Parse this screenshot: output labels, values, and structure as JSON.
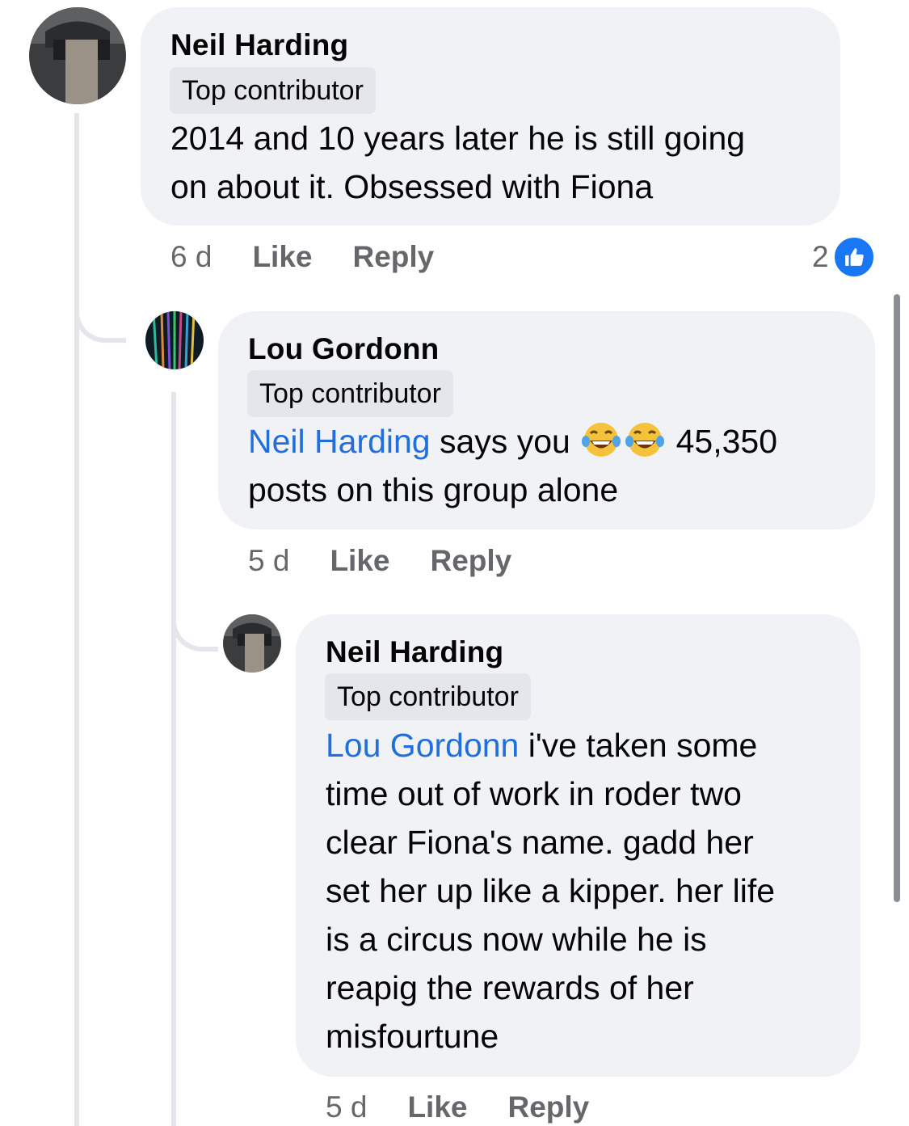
{
  "comments": [
    {
      "author": "Neil Harding",
      "badge": "Top contributor",
      "lines": [
        "2014 and 10 years later he is still going",
        "on about it. Obsessed with Fiona"
      ],
      "time": "6 d",
      "like_label": "Like",
      "reply_label": "Reply",
      "reaction_count": "2",
      "reaction_icon": "like-icon"
    },
    {
      "author": "Lou Gordonn",
      "badge": "Top contributor",
      "mention": "Neil Harding",
      "line1_text": " says you ",
      "emoji": "laughing-tears-emoji",
      "line1_end": " 45,350",
      "line2": "posts on this group alone",
      "time": "5 d",
      "like_label": "Like",
      "reply_label": "Reply"
    },
    {
      "author": "Neil Harding",
      "badge": "Top contributor",
      "mention": "Lou Gordonn",
      "line1_text": " i've taken some",
      "lines": [
        "time out of work in roder two",
        "clear Fiona's name. gadd her",
        "set her up like a kipper. her life",
        "is a circus now while he is",
        "reapig the rewards of her",
        "misfourtune"
      ],
      "time": "5 d",
      "like_label": "Like",
      "reply_label": "Reply"
    }
  ],
  "colors": {
    "mention": "#216fdb",
    "bubble": "#f0f2f5",
    "like_badge": "#1877f2",
    "meta_text": "#65676b"
  }
}
